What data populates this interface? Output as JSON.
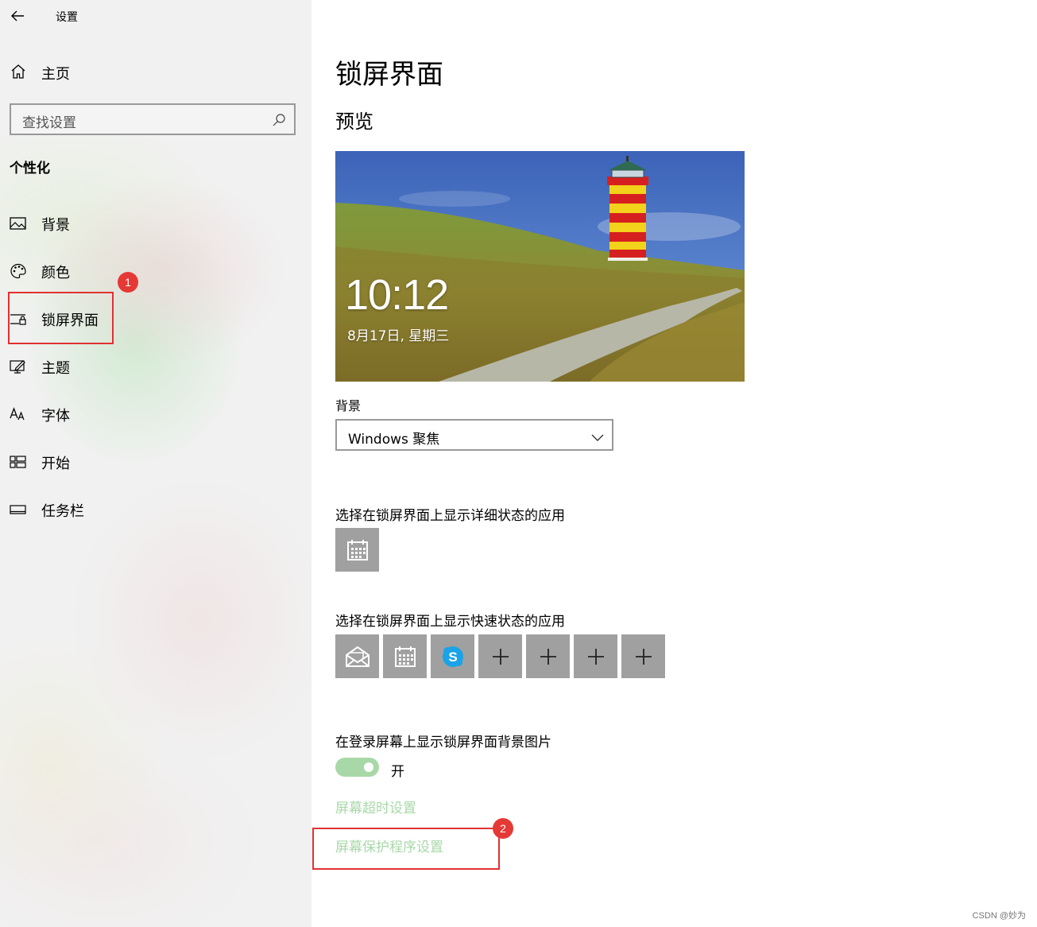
{
  "window": {
    "title": "设置"
  },
  "sidebar": {
    "home_label": "主页",
    "search_placeholder": "查找设置",
    "section_heading": "个性化",
    "items": [
      {
        "label": "背景",
        "icon": "image-icon"
      },
      {
        "label": "颜色",
        "icon": "palette-icon"
      },
      {
        "label": "锁屏界面",
        "icon": "lock-screen-icon",
        "selected": true
      },
      {
        "label": "主题",
        "icon": "theme-icon"
      },
      {
        "label": "字体",
        "icon": "font-icon"
      },
      {
        "label": "开始",
        "icon": "start-icon"
      },
      {
        "label": "任务栏",
        "icon": "taskbar-icon"
      }
    ]
  },
  "annotations": {
    "badge1": "1",
    "badge2": "2",
    "color": "#e53935"
  },
  "main": {
    "page_title": "锁屏界面",
    "preview_heading": "预览",
    "preview": {
      "time": "10:12",
      "date": "8月17日, 星期三"
    },
    "background_label": "背景",
    "background_dropdown_value": "Windows 聚焦",
    "detailed_status_label": "选择在锁屏界面上显示详细状态的应用",
    "detailed_status_apps": [
      "calendar-icon"
    ],
    "quick_status_label": "选择在锁屏界面上显示快速状态的应用",
    "quick_status_apps": [
      "mail-icon",
      "calendar-icon",
      "skype-icon",
      "plus-icon",
      "plus-icon",
      "plus-icon",
      "plus-icon"
    ],
    "sign_in_bg_label": "在登录屏幕上显示锁屏界面背景图片",
    "sign_in_bg_toggle": {
      "state_label": "开",
      "on": true
    },
    "links": {
      "screen_timeout": "屏幕超时设置",
      "screen_saver": "屏幕保护程序设置"
    }
  },
  "colors": {
    "accent_toggle": "#a8d8a8",
    "link": "#a8d8a8",
    "tile": "#a0a0a0",
    "sidebar_bg": "#f1f1f1"
  },
  "watermark": "CSDN @妙为"
}
